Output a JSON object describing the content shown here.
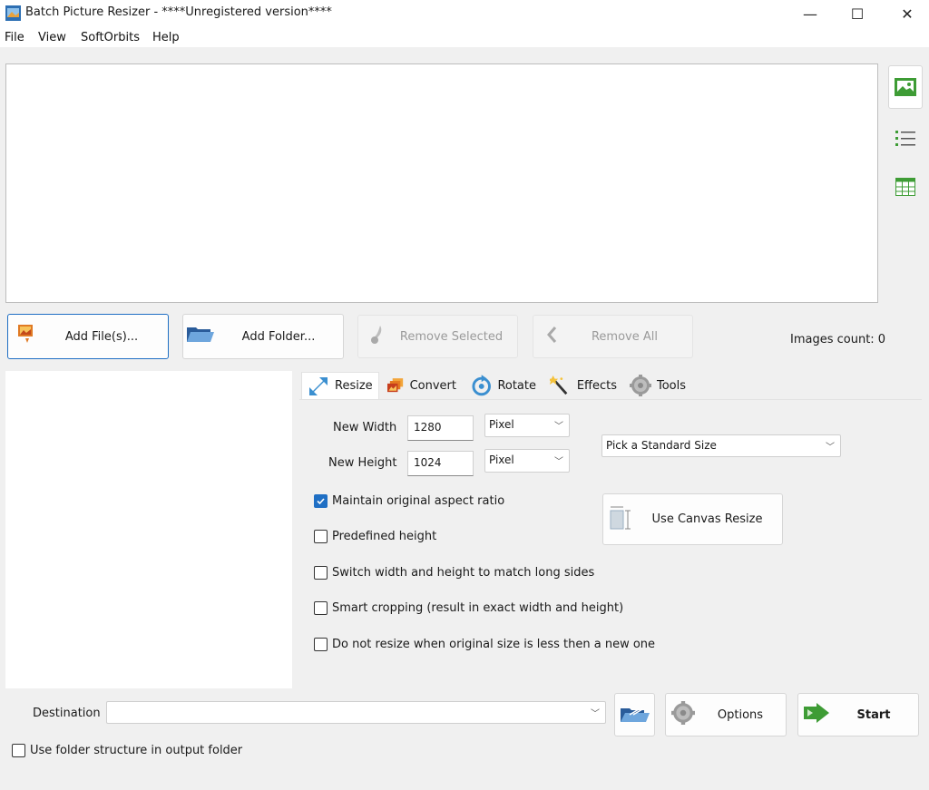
{
  "window": {
    "title": "Batch Picture Resizer - ****Unregistered version****",
    "controls": [
      "—",
      "☐",
      "✕"
    ]
  },
  "menu": [
    "File",
    "View",
    "SoftOrbits",
    "Help"
  ],
  "buttons": {
    "add_files": "Add File(s)...",
    "add_folder": "Add Folder...",
    "remove_selected": "Remove Selected",
    "remove_all": "Remove All",
    "use_canvas_resize": "Use Canvas Resize",
    "options": "Options",
    "start": "Start"
  },
  "images_count": "Images count: 0",
  "tabs": [
    "Resize",
    "Convert",
    "Rotate",
    "Effects",
    "Tools"
  ],
  "resize": {
    "new_width_label": "New Width",
    "new_width_value": "1280",
    "new_width_unit": "Pixel",
    "new_height_label": "New Height",
    "new_height_value": "1024",
    "new_height_unit": "Pixel",
    "standard_size": "Pick a Standard Size",
    "options": [
      {
        "label": "Maintain original aspect ratio",
        "checked": true
      },
      {
        "label": "Predefined height",
        "checked": false
      },
      {
        "label": "Switch width and height to match long sides",
        "checked": false
      },
      {
        "label": "Smart cropping (result in exact width and height)",
        "checked": false
      },
      {
        "label": "Do not resize when original size is less then a new one",
        "checked": false
      }
    ]
  },
  "destination": {
    "label": "Destination",
    "value": "",
    "use_folder_structure_label": "Use folder structure in output folder",
    "use_folder_structure_checked": false
  },
  "colors": {
    "accent": "#1f6fc4",
    "green_icon": "#3e9c35",
    "disabled_text": "#9a9a9a"
  }
}
